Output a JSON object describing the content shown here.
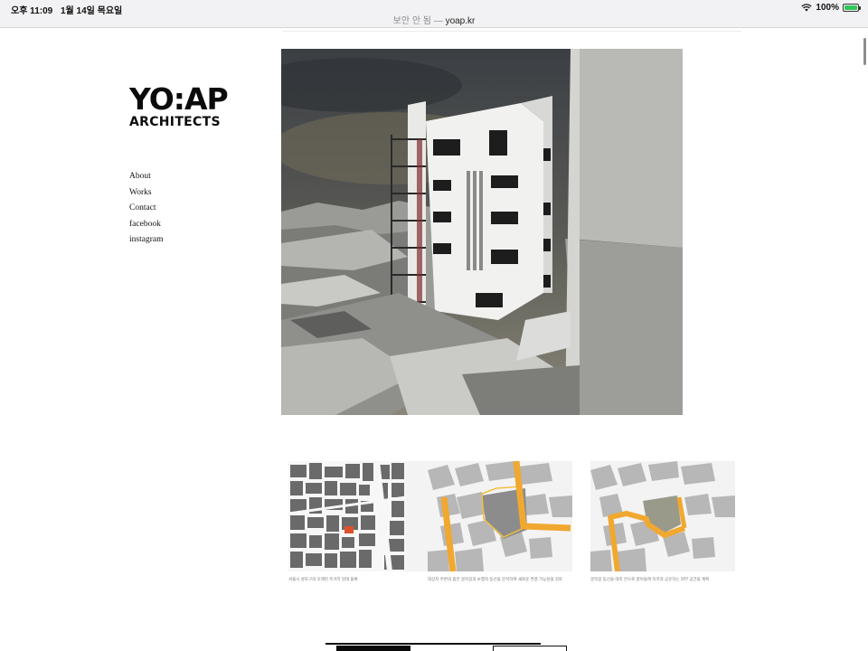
{
  "status_bar": {
    "time": "오후 11:09",
    "date": "1월 14일 목요일",
    "url_prefix": "보안 안 됨 —",
    "url_domain": "yoap.kr",
    "battery": "100%",
    "battery_level": 1.0
  },
  "logo": {
    "line1": "YO:AP",
    "line2": "ARCHITECTS"
  },
  "nav": {
    "items": [
      "About",
      "Works",
      "Contact",
      "facebook",
      "instagram"
    ]
  },
  "hero": {
    "icon": "building-render-image"
  },
  "diagrams": [
    {
      "caption": "서울시 성북구의 오래된 주거지 일대 블록"
    },
    {
      "caption": "대상지 주변의 좁은 골목길과 보행자 동선을 분석하여 새로운 연결 가능성을 검토"
    },
    {
      "caption": "골목길 동선을 대지 안으로 끌어들여 이웃과 공유하는 외부 공간을 계획"
    }
  ],
  "colors": {
    "accent_orange": "#f0a830",
    "site_red": "#e0502a"
  }
}
